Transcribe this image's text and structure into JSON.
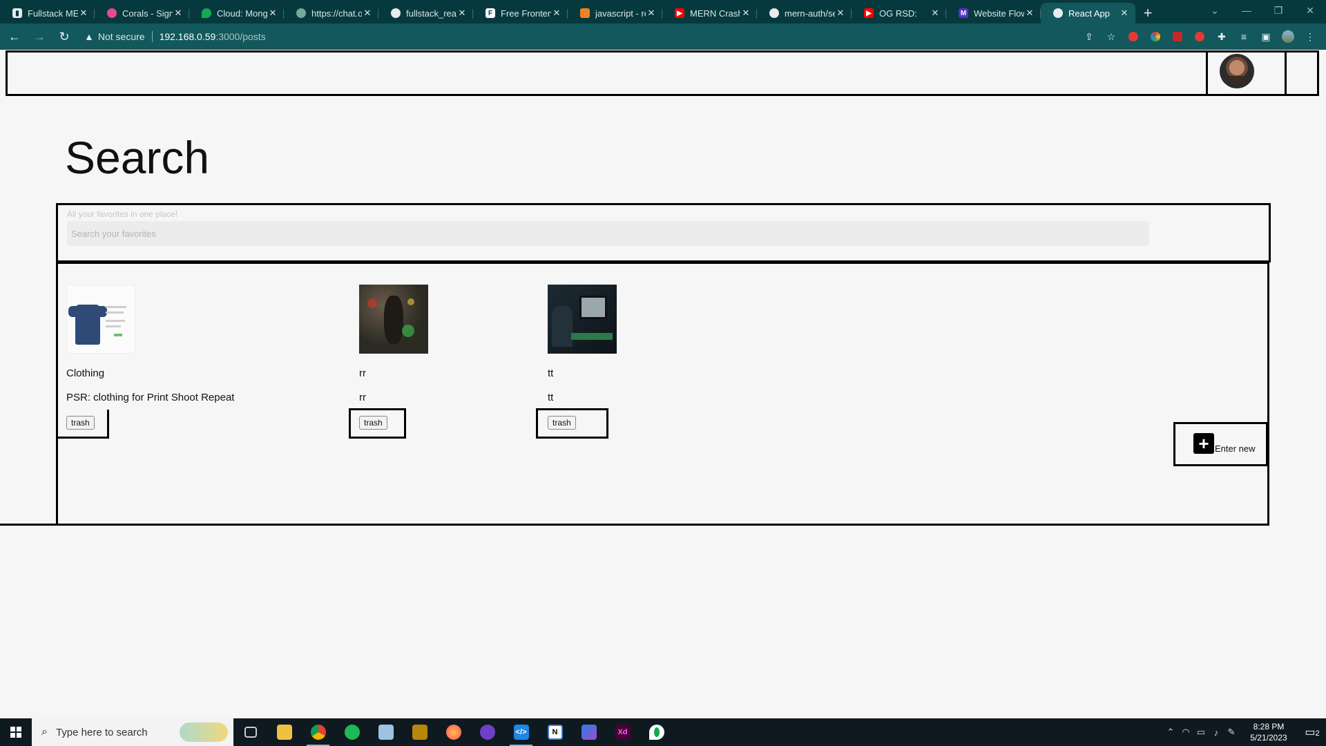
{
  "browser": {
    "tabs": [
      {
        "title": "Fullstack MERN",
        "favicon": "bookmark-icon",
        "color": "#e8eaed"
      },
      {
        "title": "Corals - Sign",
        "favicon": "corals-icon",
        "color": "#e84a8a"
      },
      {
        "title": "Cloud: Mongo",
        "favicon": "mongodb-leaf-icon",
        "color": "#13aa52"
      },
      {
        "title": "https://chat.o",
        "favicon": "openai-icon",
        "color": "#74aa9c"
      },
      {
        "title": "fullstack_reac",
        "favicon": "github-icon",
        "color": "#e8eaed"
      },
      {
        "title": "Free Frontend",
        "favicon": "f-logo-icon",
        "color": "#ffffff"
      },
      {
        "title": "javascript - re",
        "favicon": "stackoverflow-icon",
        "color": "#f48024"
      },
      {
        "title": "MERN Crash",
        "favicon": "youtube-icon",
        "color": "#ff0000"
      },
      {
        "title": "mern-auth/se",
        "favicon": "github-icon",
        "color": "#e8eaed"
      },
      {
        "title": "OG RSD:",
        "favicon": "youtube-icon",
        "color": "#ff0000"
      },
      {
        "title": "Website Flow",
        "favicon": "miro-m-icon",
        "color": "#5b2fc9"
      },
      {
        "title": "React App",
        "favicon": "globe-icon",
        "color": "#e8eaed",
        "active": true
      }
    ],
    "new_tab": "+",
    "address": {
      "security": "Not secure",
      "host": "192.168.0.59",
      "path": ":3000/posts"
    }
  },
  "page": {
    "heading": "Search",
    "search": {
      "label": "All your favorites in one place!",
      "placeholder": "Search your favorites",
      "value": ""
    },
    "posts": [
      {
        "title": "Clothing",
        "description": "PSR: clothing for Print Shoot Repeat",
        "image": "shirt-product-thumbnail",
        "delete_label": "trash"
      },
      {
        "title": "rr",
        "description": "rr",
        "image": "dark-figure-thumbnail",
        "delete_label": "trash"
      },
      {
        "title": "tt",
        "description": "tt",
        "image": "computer-desk-thumbnail",
        "delete_label": "trash"
      }
    ],
    "enter_new": {
      "icon": "plus-icon",
      "label": "Enter new"
    }
  },
  "taskbar": {
    "search_placeholder": "Type here to search",
    "time": "8:28 PM",
    "date": "5/21/2023",
    "notification_count": "2",
    "apps": [
      "task-view-icon",
      "file-explorer-icon",
      "chrome-icon",
      "spotify-icon",
      "notepad-icon",
      "folder-app-icon",
      "firefox-icon",
      "github-desktop-icon",
      "vscode-icon",
      "notion-icon",
      "power-automate-icon",
      "adobe-xd-icon",
      "mongodb-compass-icon"
    ]
  }
}
